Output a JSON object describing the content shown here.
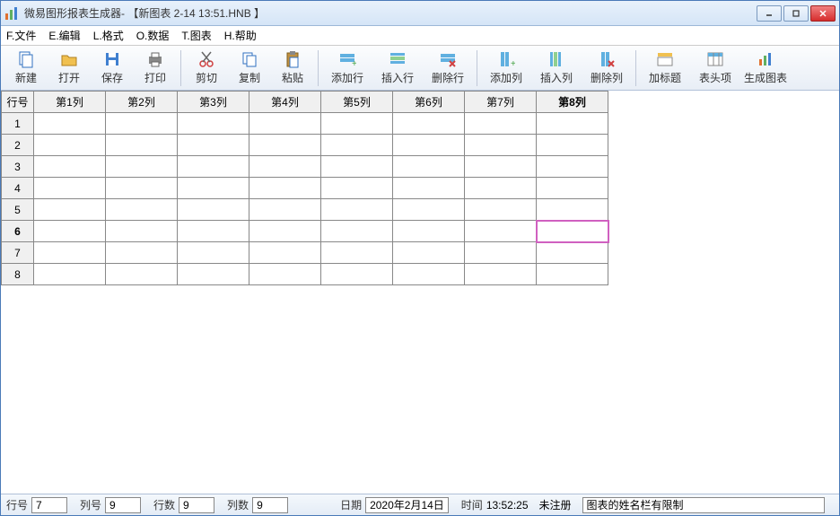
{
  "window": {
    "title": "微易图形报表生成器- 【新图表 2-14 13:51.HNB 】"
  },
  "menu": {
    "file": "F.文件",
    "edit": "E.编辑",
    "format": "L.格式",
    "data": "O.数据",
    "chart": "T.图表",
    "help": "H.帮助"
  },
  "toolbar": {
    "new": "新建",
    "open": "打开",
    "save": "保存",
    "print": "打印",
    "cut": "剪切",
    "copy": "复制",
    "paste": "粘贴",
    "addRow": "添加行",
    "insertRow": "插入行",
    "deleteRow": "删除行",
    "addCol": "添加列",
    "insertCol": "插入列",
    "deleteCol": "删除列",
    "addTitle": "加标题",
    "tableHeader": "表头项",
    "generateChart": "生成图表"
  },
  "grid": {
    "rowHeader": "行号",
    "columns": [
      "第1列",
      "第2列",
      "第3列",
      "第4列",
      "第5列",
      "第6列",
      "第7列",
      "第8列"
    ],
    "rows": [
      "1",
      "2",
      "3",
      "4",
      "5",
      "6",
      "7",
      "8"
    ],
    "selectedRow": 6,
    "selectedCol": 8
  },
  "status": {
    "rowLabel": "行号",
    "rowValue": "7",
    "colLabel": "列号",
    "colValue": "9",
    "rowCountLabel": "行数",
    "rowCountValue": "9",
    "colCountLabel": "列数",
    "colCountValue": "9",
    "dateLabel": "日期",
    "dateValue": "2020年2月14日",
    "timeLabel": "时间",
    "timeValue": "13:52:25",
    "register": "未注册",
    "note": "图表的姓名栏有限制"
  }
}
